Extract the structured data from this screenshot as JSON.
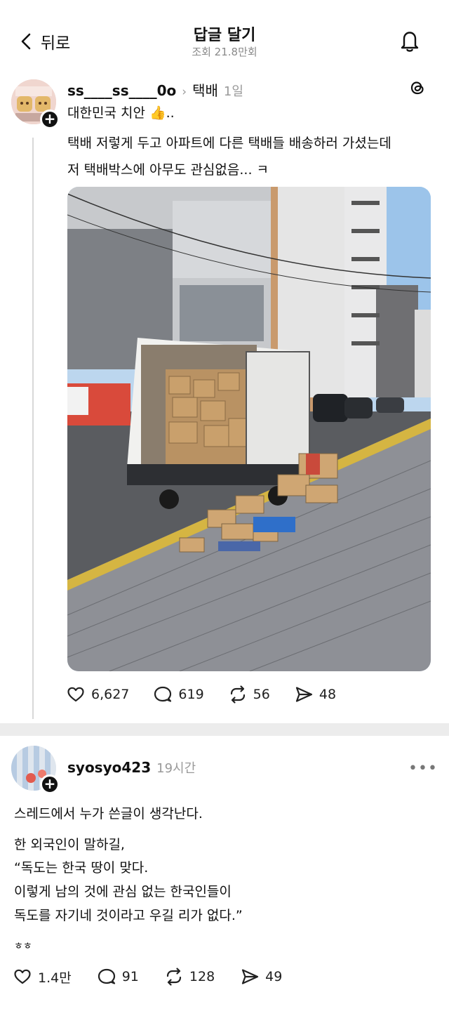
{
  "header": {
    "back_label": "뒤로",
    "title": "답글 달기",
    "views": "조회 21.8만회"
  },
  "post": {
    "username": "ss____ss____0o",
    "topic": "택배",
    "time": "1일",
    "line1": "대한민국 치안 👍..",
    "line2": "택배 저렇게 두고 아파트에 다른 택배들 배송하러 가셨는데",
    "line3": "저 택배박스에 아무도 관심없음... ㅋ",
    "likes": "6,627",
    "replies": "619",
    "reposts": "56",
    "shares": "48"
  },
  "reply": {
    "username": "syosyo423",
    "time": "19시간",
    "line1": "스레드에서 누가 쓴글이 생각난다.",
    "line2": "한 외국인이 말하길,",
    "line3": "“독도는 한국 땅이 맞다.",
    "line4": "이렇게 남의 것에 관심 없는 한국인들이",
    "line5": "독도를 자기네 것이라고 우길 리가 없다.”",
    "line6": "ㅎㅎ",
    "likes": "1.4만",
    "replies": "91",
    "reposts": "128",
    "shares": "49"
  },
  "icons": {
    "back": "chevron-left-icon",
    "notifications": "bell-icon",
    "app": "threads-logo-icon",
    "like": "heart-icon",
    "reply": "comment-icon",
    "repost": "repost-icon",
    "share": "send-icon",
    "more": "more-icon"
  },
  "colors": {
    "background": "#ececec",
    "card": "#ffffff",
    "muted_text": "#8a8a8a",
    "primary_text": "#101010"
  }
}
